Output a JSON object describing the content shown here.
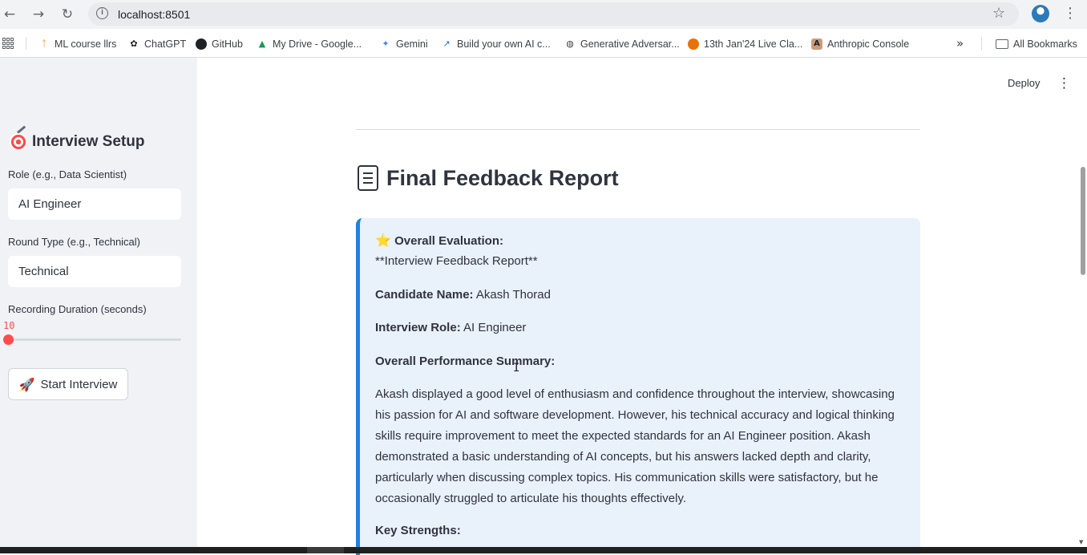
{
  "browser": {
    "url": "localhost:8501",
    "bookmarks": [
      {
        "label": "ML course llrs",
        "icon": "ml-course-icon",
        "color": "#e37400"
      },
      {
        "label": "ChatGPT",
        "icon": "chatgpt-icon",
        "color": "#202124"
      },
      {
        "label": "GitHub",
        "icon": "github-icon",
        "color": "#202124"
      },
      {
        "label": "My Drive - Google...",
        "icon": "google-drive-icon",
        "color": "#0f9d58"
      },
      {
        "label": "Gemini",
        "icon": "gemini-icon",
        "color": "#4285f4"
      },
      {
        "label": "Build your own AI c...",
        "icon": "trend-icon",
        "color": "#1a73e8"
      },
      {
        "label": "Generative Adversar...",
        "icon": "globe-icon",
        "color": "#3c4043"
      },
      {
        "label": "13th Jan'24 Live Cla...",
        "icon": "live-class-icon",
        "color": "#e8710a"
      },
      {
        "label": "Anthropic Console",
        "icon": "anthropic-icon",
        "color": "#cc9b7a"
      }
    ],
    "all_bookmarks": "All Bookmarks"
  },
  "sidebar": {
    "title": "Interview Setup",
    "role_label": "Role (e.g., Data Scientist)",
    "role_value": "AI Engineer",
    "round_label": "Round Type (e.g., Technical)",
    "round_value": "Technical",
    "duration_label": "Recording Duration (seconds)",
    "duration_value": "10",
    "start_button": "Start Interview"
  },
  "header": {
    "deploy": "Deploy"
  },
  "report": {
    "title": "Final Feedback Report",
    "overall_label": "Overall Evaluation:",
    "raw_heading": "**Interview Feedback Report**",
    "candidate_label": "Candidate Name:",
    "candidate_value": "Akash Thorad",
    "role_label": "Interview Role:",
    "role_value": "AI Engineer",
    "summary_label": "Overall Performance Summary:",
    "summary_lines": [
      "Akash displayed a good level of enthusiasm and confidence throughout the interview, showcasing",
      "his passion for AI and software development. However, his technical accuracy and logical thinking",
      "skills require improvement to meet the expected standards for an AI Engineer position. Akash",
      "demonstrated a basic understanding of AI concepts, but his answers lacked depth and clarity,",
      "particularly when discussing complex topics. His communication skills were satisfactory, but he",
      "occasionally struggled to articulate his thoughts effectively."
    ],
    "strengths_label": "Key Strengths:"
  },
  "colors": {
    "accent": "#ff4b4b",
    "info_bg": "#e9f1fb",
    "info_border": "#1c83e1",
    "sidebar_bg": "#f0f2f6"
  }
}
